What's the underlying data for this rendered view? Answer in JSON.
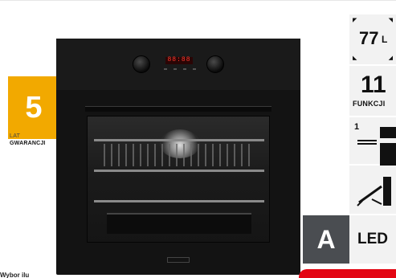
{
  "warranty": {
    "number": "5",
    "label_small": "LAT",
    "label_main": "GWARANCJI"
  },
  "features": {
    "capacity": {
      "value": "77",
      "unit": "L",
      "icon": "expand-corners-icon"
    },
    "functions": {
      "value": "11",
      "label": "FUNKCJI"
    },
    "telescopic": {
      "value": "1",
      "icon": "telescopic-rail-icon"
    },
    "probe": {
      "icon": "meat-probe-icon"
    },
    "energy": {
      "class": "A",
      "color": "#4a4d51"
    },
    "light": {
      "label": "LED"
    }
  },
  "oven": {
    "display": "88:88",
    "display_color": "#ff3b2f"
  },
  "footer": {
    "text": "Wybor ilu"
  },
  "colors": {
    "warranty": "#f2a900",
    "cta": "#e30613",
    "tile_bg": "#f2f2f2"
  }
}
